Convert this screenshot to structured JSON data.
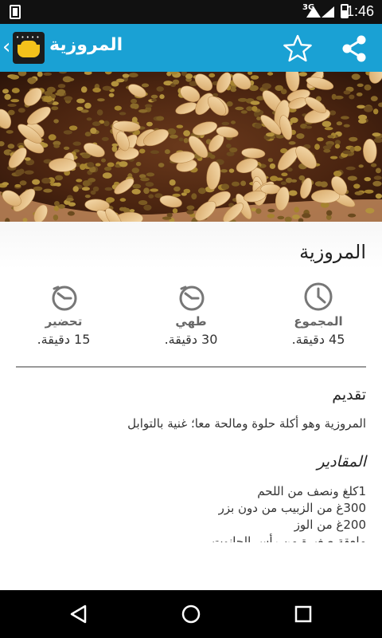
{
  "status_bar": {
    "time": "1:46",
    "network": "3G"
  },
  "app_bar": {
    "title": "المروزية",
    "icons": [
      "back-chevron-icon",
      "app-logo",
      "star-icon",
      "share-icon"
    ],
    "color": "#1aa1d4"
  },
  "recipe": {
    "title": "المروزية",
    "times": {
      "prep": {
        "label": "تحضير",
        "value": "15 دقيقة."
      },
      "cook": {
        "label": "طهي",
        "value": "30 دقيقة."
      },
      "total": {
        "label": "المجموع",
        "value": "45 دقيقة."
      }
    },
    "intro": {
      "title": "تقديم",
      "text": "المروزية وهو أكلة حلوة ومالحة معا؛ غنية بالتوابل"
    },
    "ingredients": {
      "title": "المقادير",
      "items": [
        "1كلغ ونصف من اللحم",
        "300غ من الزبيب من دون بزر",
        "200غ من الوز",
        "ملعقة صغيرة من رأس الحانوت"
      ]
    }
  },
  "nav_bar": {
    "icons": [
      "back-triangle-icon",
      "home-circle-icon",
      "recents-square-icon"
    ]
  }
}
